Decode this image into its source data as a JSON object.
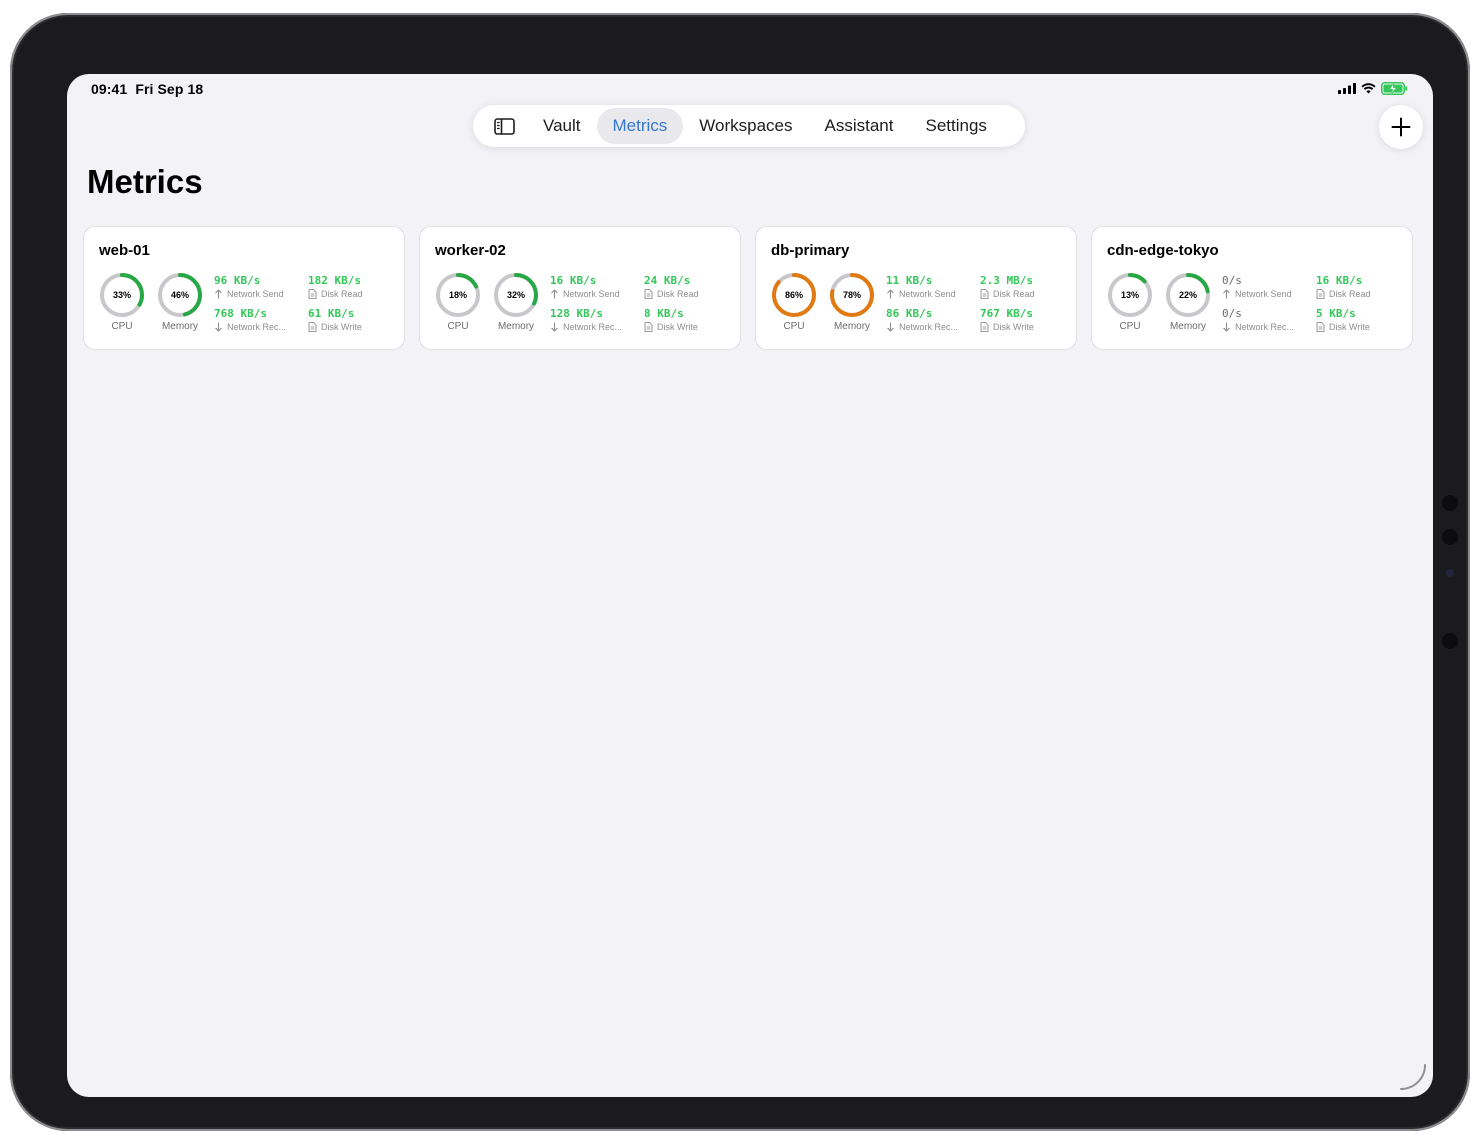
{
  "status": {
    "time": "09:41",
    "date": "Fri Sep 18",
    "icons": [
      "cellular-signal-icon",
      "wifi-icon",
      "battery-charging-icon"
    ],
    "battery_color": "#34c759"
  },
  "tabbar": {
    "sidebar_icon": "sidebar-toggle-icon",
    "tabs": [
      {
        "label": "Vault",
        "active": false
      },
      {
        "label": "Metrics",
        "active": true
      },
      {
        "label": "Workspaces",
        "active": false
      },
      {
        "label": "Assistant",
        "active": false
      },
      {
        "label": "Settings",
        "active": false
      }
    ],
    "accent_color": "#3478d1"
  },
  "add_button": {
    "icon": "plus-icon"
  },
  "page": {
    "title": "Metrics"
  },
  "labels": {
    "cpu": "CPU",
    "memory": "Memory",
    "network_send": "Network Send",
    "network_receive": "Network Rec...",
    "disk_read": "Disk Read",
    "disk_write": "Disk Write"
  },
  "colors": {
    "ok": "#28a745",
    "warn": "#e07a12",
    "track": "#c7c7cc",
    "value_green": "#34c759"
  },
  "servers": [
    {
      "name": "web-01",
      "cpu": "33%",
      "cpu_value": 33,
      "memory": "46%",
      "memory_value": 46,
      "network_send": "96 KB/s",
      "network_receive": "768 KB/s",
      "disk_read": "182 KB/s",
      "disk_write": "61 KB/s"
    },
    {
      "name": "worker-02",
      "cpu": "18%",
      "cpu_value": 18,
      "memory": "32%",
      "memory_value": 32,
      "network_send": "16 KB/s",
      "network_receive": "128 KB/s",
      "disk_read": "24 KB/s",
      "disk_write": "8 KB/s"
    },
    {
      "name": "db-primary",
      "cpu": "86%",
      "cpu_value": 86,
      "memory": "78%",
      "memory_value": 78,
      "network_send": "11 KB/s",
      "network_receive": "86 KB/s",
      "disk_read": "2.3 MB/s",
      "disk_write": "767 KB/s"
    },
    {
      "name": "cdn-edge-tokyo",
      "cpu": "13%",
      "cpu_value": 13,
      "memory": "22%",
      "memory_value": 22,
      "network_send": "0/s",
      "network_receive": "0/s",
      "disk_read": "16 KB/s",
      "disk_write": "5 KB/s"
    }
  ]
}
